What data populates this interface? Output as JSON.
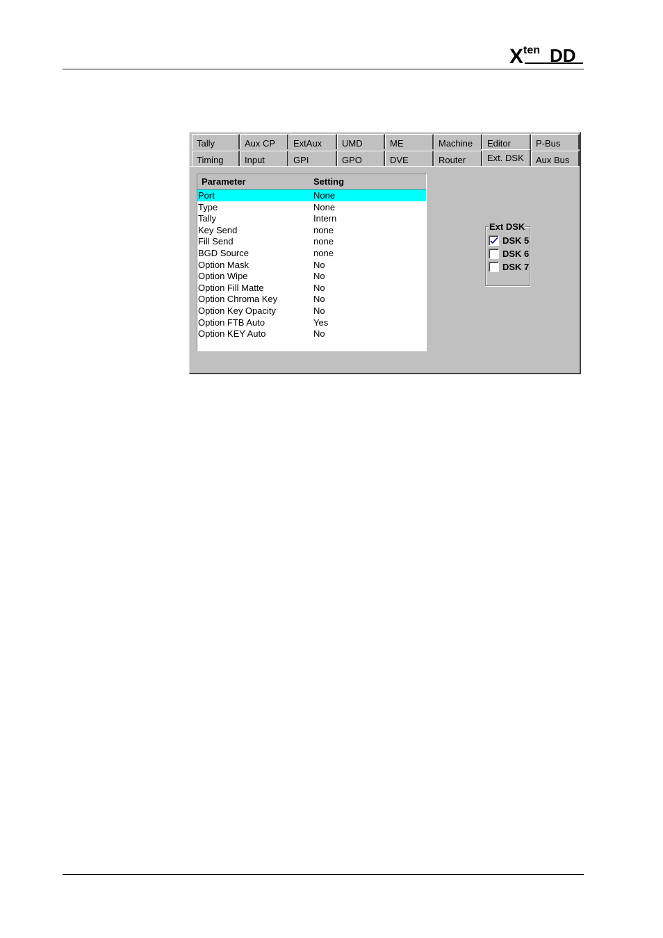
{
  "dialog": {
    "tabs_row1": [
      "Tally",
      "Aux CP",
      "ExtAux",
      "UMD",
      "ME",
      "Machine",
      "Editor",
      "P-Bus"
    ],
    "tabs_row2": [
      "Timing",
      "Input",
      "GPI",
      "GPO",
      "DVE",
      "Router",
      "Ext. DSK",
      "Aux Bus"
    ],
    "active_tab": "Ext. DSK",
    "table": {
      "headers": [
        "Parameter",
        "Setting"
      ],
      "selected_row": 0,
      "rows": [
        [
          "Port",
          "None"
        ],
        [
          "Type",
          "None"
        ],
        [
          "Tally",
          "Intern"
        ],
        [
          "Key Send",
          "none"
        ],
        [
          "Fill Send",
          "none"
        ],
        [
          "BGD Source",
          "none"
        ],
        [
          "Option Mask",
          "No"
        ],
        [
          "Option Wipe",
          "No"
        ],
        [
          "Option Fill Matte",
          "No"
        ],
        [
          "Option Chroma Key",
          "No"
        ],
        [
          "Option Key Opacity",
          "No"
        ],
        [
          "Option FTB Auto",
          "Yes"
        ],
        [
          "Option KEY Auto",
          "No"
        ]
      ]
    },
    "group": {
      "title": "Ext DSK",
      "items": [
        {
          "label": "DSK 5",
          "checked": true
        },
        {
          "label": "DSK 6",
          "checked": false
        },
        {
          "label": "DSK 7",
          "checked": false
        }
      ]
    }
  },
  "colors": {
    "panel": "#c0c0c0",
    "selection": "#00ffff",
    "check": "#00008b"
  }
}
